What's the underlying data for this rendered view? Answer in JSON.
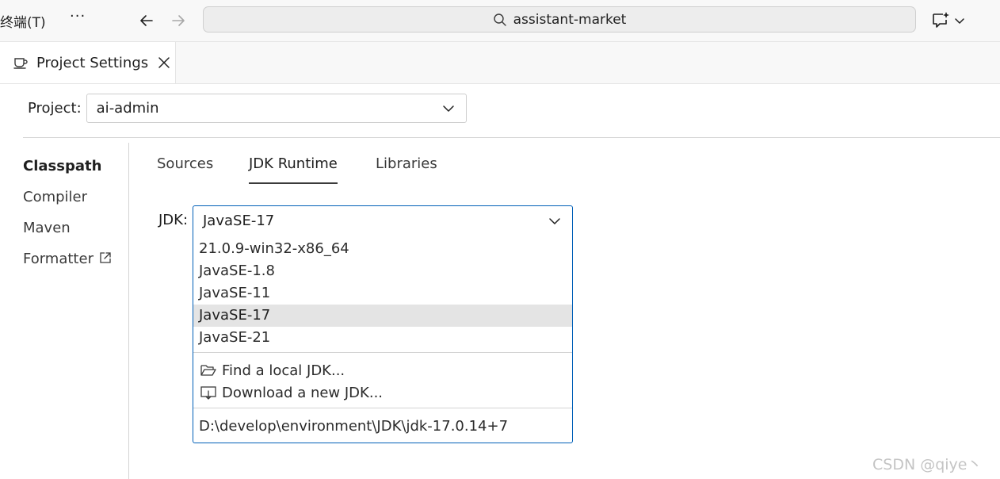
{
  "titlebar": {
    "menu_terminal": "终端(T)",
    "more_label": "···",
    "search_text": "assistant-market"
  },
  "editor_tab": {
    "label": "Project Settings"
  },
  "project": {
    "label": "Project:",
    "value": "ai-admin"
  },
  "sidebar": {
    "items": [
      {
        "label": "Classpath",
        "active": true
      },
      {
        "label": "Compiler",
        "active": false
      },
      {
        "label": "Maven",
        "active": false
      },
      {
        "label": "Formatter",
        "active": false,
        "external": true
      }
    ]
  },
  "subtabs": [
    {
      "label": "Sources",
      "active": false
    },
    {
      "label": "JDK Runtime",
      "active": true
    },
    {
      "label": "Libraries",
      "active": false
    }
  ],
  "jdk": {
    "label": "JDK:",
    "value": "JavaSE-17",
    "options": [
      "21.0.9-win32-x86_64",
      "JavaSE-1.8",
      "JavaSE-11",
      "JavaSE-17",
      "JavaSE-21"
    ],
    "selected_option": "JavaSE-17",
    "actions": [
      {
        "label": "Find a local JDK...",
        "icon": "folder-open-icon"
      },
      {
        "label": "Download a new JDK...",
        "icon": "download-icon"
      }
    ],
    "path": "D:\\develop\\environment\\JDK\\jdk-17.0.14+7"
  },
  "watermark": "CSDN @qiye丶",
  "colors": {
    "accent_border": "#005fb8",
    "selected_bg": "#e4e4e4"
  }
}
